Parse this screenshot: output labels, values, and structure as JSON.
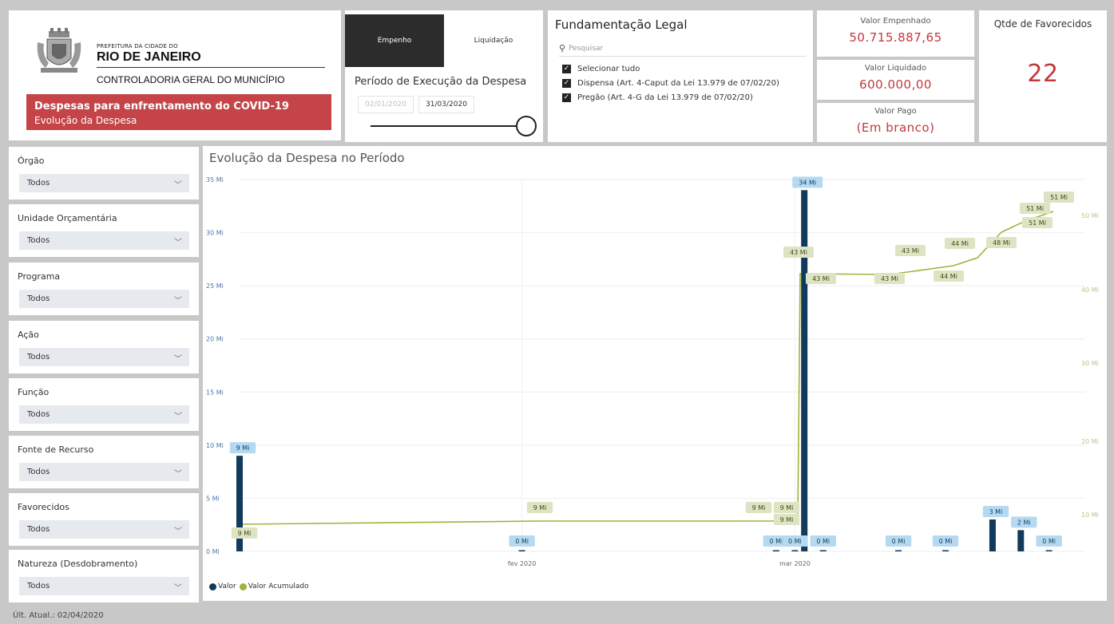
{
  "header": {
    "prefeitura_small": "PREFEITURA DA CIDADE DO",
    "city": "RIO DE JANEIRO",
    "controladoria": "CONTROLADORIA GERAL DO MUNICÍPIO",
    "banner_title": "Despesas para enfrentamento do COVID-19",
    "banner_subtitle": "Evolução da Despesa",
    "banner_color": "#c44447"
  },
  "toggle": {
    "empenho": "Empenho",
    "liquidacao": "Liquidação",
    "active": "Empenho"
  },
  "period": {
    "title": "Período de Execução da Despesa",
    "start": "02/01/2020",
    "end": "31/03/2020"
  },
  "fundamentacao": {
    "title": "Fundamentação Legal",
    "search_placeholder": "Pesquisar",
    "options": [
      {
        "label": "Selecionar tudo",
        "checked": true
      },
      {
        "label": "Dispensa (Art. 4-Caput da Lei 13.979 de 07/02/20)",
        "checked": true
      },
      {
        "label": "Pregão (Art. 4-G da Lei 13.979 de 07/02/20)",
        "checked": true
      }
    ]
  },
  "kpis": {
    "empenhado_label": "Valor Empenhado",
    "empenhado_value": "50.715.887,65",
    "liquidado_label": "Valor Liquidado",
    "liquidado_value": "600.000,00",
    "pago_label": "Valor Pago",
    "pago_value": "(Em branco)",
    "favorecidos_label": "Qtde de Favorecidos",
    "favorecidos_value": "22",
    "accent": "#c0393e"
  },
  "slicers": [
    {
      "label": "Órgão",
      "value": "Todos"
    },
    {
      "label": "Unidade Orçamentária",
      "value": "Todos"
    },
    {
      "label": "Programa",
      "value": "Todos"
    },
    {
      "label": "Ação",
      "value": "Todos"
    },
    {
      "label": "Função",
      "value": "Todos"
    },
    {
      "label": "Fonte de Recurso",
      "value": "Todos"
    },
    {
      "label": "Favorecidos",
      "value": "Todos"
    },
    {
      "label": "Natureza (Desdobramento)",
      "value": "Todos"
    }
  ],
  "chart": {
    "title": "Evolução da Despesa no Período",
    "legend_valor": "Valor",
    "legend_acumulado": "Valor Acumulado",
    "colors": {
      "valor": "#113a5c",
      "acumulado": "#9fb43a"
    }
  },
  "chart_data": {
    "type": "bar",
    "title": "Evolução da Despesa no Período",
    "left_axis": {
      "ticks": [
        "0 Mi",
        "5 Mi",
        "10 Mi",
        "15 Mi",
        "20 Mi",
        "25 Mi",
        "30 Mi",
        "35 Mi"
      ],
      "range": [
        0,
        35
      ]
    },
    "right_axis": {
      "ticks": [
        "10 Mi",
        "20 Mi",
        "30 Mi",
        "40 Mi",
        "50 Mi"
      ]
    },
    "x_ticks": [
      "fev 2020",
      "mar 2020"
    ],
    "series": [
      {
        "name": "Valor",
        "points": [
          {
            "x": "2020-01-02",
            "y": 9,
            "label": "9 Mi"
          },
          {
            "x": "2020-02-01",
            "y": 0,
            "label": "0 Mi"
          },
          {
            "x": "2020-02-28",
            "y": 0,
            "label": "0 Mi"
          },
          {
            "x": "2020-03-01",
            "y": 0,
            "label": "0 Mi"
          },
          {
            "x": "2020-03-02",
            "y": 34,
            "label": "34 Mi"
          },
          {
            "x": "2020-03-04",
            "y": 0,
            "label": "0 Mi"
          },
          {
            "x": "2020-03-12",
            "y": 0,
            "label": "0 Mi"
          },
          {
            "x": "2020-03-17",
            "y": 0,
            "label": "0 Mi"
          },
          {
            "x": "2020-03-22",
            "y": 3,
            "label": "3 Mi"
          },
          {
            "x": "2020-03-25",
            "y": 2,
            "label": "2 Mi"
          },
          {
            "x": "2020-03-28",
            "y": 0,
            "label": "0 Mi"
          }
        ]
      },
      {
        "name": "Valor Acumulado",
        "labels": [
          "9 Mi",
          "9 Mi",
          "9 Mi",
          "9 Mi",
          "9 Mi",
          "43 Mi",
          "43 Mi",
          "43 Mi",
          "43 Mi",
          "44 Mi",
          "44 Mi",
          "48 Mi",
          "51 Mi",
          "51 Mi",
          "51 Mi"
        ]
      }
    ]
  },
  "footer": {
    "update": "Últ. Atual.: 02/04/2020"
  }
}
